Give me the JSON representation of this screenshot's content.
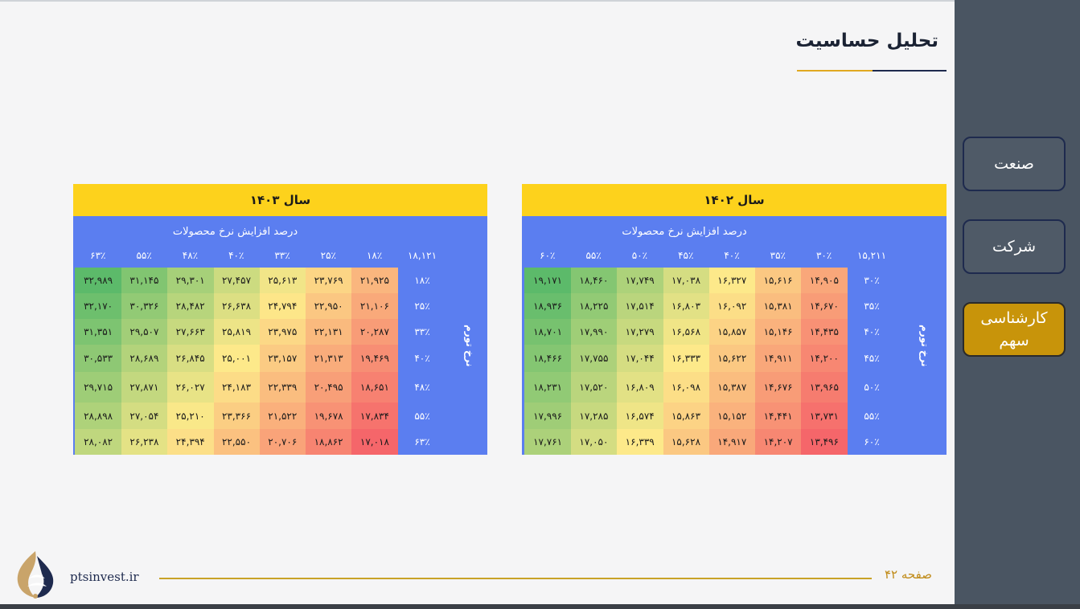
{
  "page": {
    "title": "تحلیل حساسیت",
    "page_label": "صفحه ۴۲",
    "website": "ptsinvest.ir"
  },
  "sidebar": {
    "items": [
      {
        "label": "صنعت",
        "active": false
      },
      {
        "label": "شرکت",
        "active": false
      },
      {
        "label": "کارشناسی سهم",
        "active": true
      }
    ]
  },
  "colors": {
    "header_yellow": "#fdd21c",
    "table_blue": "#5b7ef0",
    "sidebar": "#4a5562",
    "active_gold": "#c8940a",
    "heat_low": "#f5666a",
    "heat_mid": "#fde98a",
    "heat_high": "#5cba6a"
  },
  "tables": [
    {
      "title": "سال ۱۴۰۲",
      "subtitle": "درصد افزایش نرخ محصولات",
      "row_axis_label": "نرخ تورم",
      "corner": "۱۵,۲۱۱",
      "columns": [
        "۳۰٪",
        "۳۵٪",
        "۴۰٪",
        "۴۵٪",
        "۵۰٪",
        "۵۵٪",
        "۶۰٪"
      ],
      "rows": [
        {
          "label": "۳۰٪",
          "cells": [
            "۱۴,۹۰۵",
            "۱۵,۶۱۶",
            "۱۶,۳۲۷",
            "۱۷,۰۳۸",
            "۱۷,۷۴۹",
            "۱۸,۴۶۰",
            "۱۹,۱۷۱"
          ]
        },
        {
          "label": "۳۵٪",
          "cells": [
            "۱۴,۶۷۰",
            "۱۵,۳۸۱",
            "۱۶,۰۹۲",
            "۱۶,۸۰۳",
            "۱۷,۵۱۴",
            "۱۸,۲۲۵",
            "۱۸,۹۳۶"
          ]
        },
        {
          "label": "۴۰٪",
          "cells": [
            "۱۴,۴۳۵",
            "۱۵,۱۴۶",
            "۱۵,۸۵۷",
            "۱۶,۵۶۸",
            "۱۷,۲۷۹",
            "۱۷,۹۹۰",
            "۱۸,۷۰۱"
          ]
        },
        {
          "label": "۴۵٪",
          "cells": [
            "۱۴,۲۰۰",
            "۱۴,۹۱۱",
            "۱۵,۶۲۲",
            "۱۶,۳۳۳",
            "۱۷,۰۴۴",
            "۱۷,۷۵۵",
            "۱۸,۴۶۶"
          ]
        },
        {
          "label": "۵۰٪",
          "cells": [
            "۱۳,۹۶۵",
            "۱۴,۶۷۶",
            "۱۵,۳۸۷",
            "۱۶,۰۹۸",
            "۱۶,۸۰۹",
            "۱۷,۵۲۰",
            "۱۸,۲۳۱"
          ]
        },
        {
          "label": "۵۵٪",
          "cells": [
            "۱۳,۷۳۱",
            "۱۴,۴۴۱",
            "۱۵,۱۵۲",
            "۱۵,۸۶۳",
            "۱۶,۵۷۴",
            "۱۷,۲۸۵",
            "۱۷,۹۹۶"
          ]
        },
        {
          "label": "۶۰٪",
          "cells": [
            "۱۳,۴۹۶",
            "۱۴,۲۰۷",
            "۱۴,۹۱۷",
            "۱۵,۶۲۸",
            "۱۶,۳۳۹",
            "۱۷,۰۵۰",
            "۱۷,۷۶۱"
          ]
        }
      ]
    },
    {
      "title": "سال ۱۴۰۳",
      "subtitle": "درصد افزایش نرخ محصولات",
      "row_axis_label": "نرخ تورم",
      "corner": "۱۸,۱۲۱",
      "columns": [
        "۱۸٪",
        "۲۵٪",
        "۳۳٪",
        "۴۰٪",
        "۴۸٪",
        "۵۵٪",
        "۶۳٪"
      ],
      "rows": [
        {
          "label": "۱۸٪",
          "cells": [
            "۲۱,۹۲۵",
            "۲۳,۷۶۹",
            "۲۵,۶۱۳",
            "۲۷,۴۵۷",
            "۲۹,۳۰۱",
            "۳۱,۱۴۵",
            "۳۲,۹۸۹"
          ]
        },
        {
          "label": "۲۵٪",
          "cells": [
            "۲۱,۱۰۶",
            "۲۲,۹۵۰",
            "۲۴,۷۹۴",
            "۲۶,۶۳۸",
            "۲۸,۴۸۲",
            "۳۰,۳۲۶",
            "۳۲,۱۷۰"
          ]
        },
        {
          "label": "۳۳٪",
          "cells": [
            "۲۰,۲۸۷",
            "۲۲,۱۳۱",
            "۲۳,۹۷۵",
            "۲۵,۸۱۹",
            "۲۷,۶۶۳",
            "۲۹,۵۰۷",
            "۳۱,۳۵۱"
          ]
        },
        {
          "label": "۴۰٪",
          "cells": [
            "۱۹,۴۶۹",
            "۲۱,۳۱۳",
            "۲۳,۱۵۷",
            "۲۵,۰۰۱",
            "۲۶,۸۴۵",
            "۲۸,۶۸۹",
            "۳۰,۵۳۳"
          ]
        },
        {
          "label": "۴۸٪",
          "cells": [
            "۱۸,۶۵۱",
            "۲۰,۴۹۵",
            "۲۲,۳۳۹",
            "۲۴,۱۸۳",
            "۲۶,۰۲۷",
            "۲۷,۸۷۱",
            "۲۹,۷۱۵"
          ]
        },
        {
          "label": "۵۵٪",
          "cells": [
            "۱۷,۸۳۴",
            "۱۹,۶۷۸",
            "۲۱,۵۲۲",
            "۲۳,۳۶۶",
            "۲۵,۲۱۰",
            "۲۷,۰۵۴",
            "۲۸,۸۹۸"
          ]
        },
        {
          "label": "۶۳٪",
          "cells": [
            "۱۷,۰۱۸",
            "۱۸,۸۶۲",
            "۲۰,۷۰۶",
            "۲۲,۵۵۰",
            "۲۴,۳۹۴",
            "۲۶,۲۳۸",
            "۲۸,۰۸۲"
          ]
        }
      ]
    }
  ]
}
